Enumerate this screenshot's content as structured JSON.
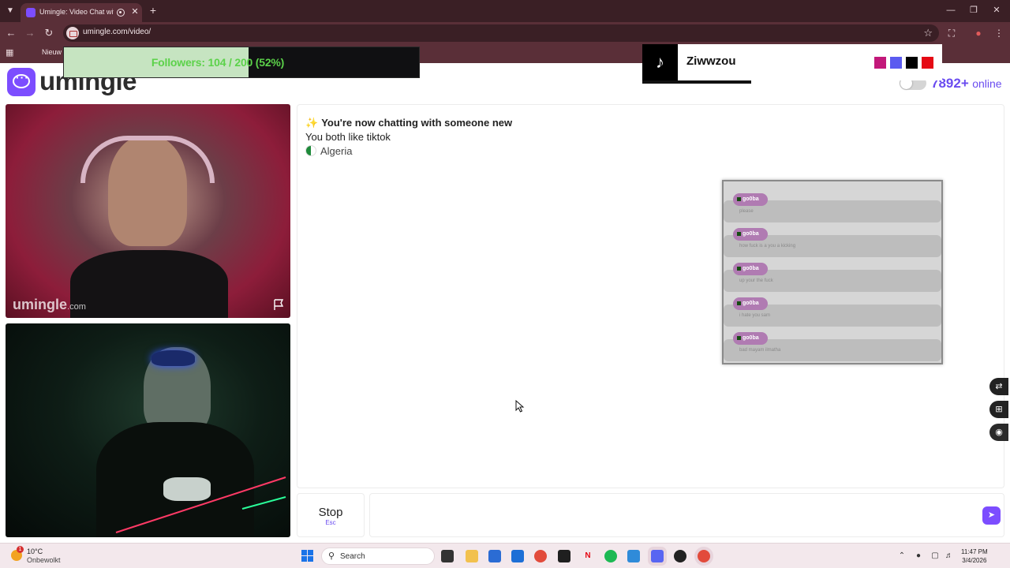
{
  "browser": {
    "tab_title": "Umingle: Video Chat with S",
    "url": "umingle.com/video/",
    "bookmark": "Nieuw"
  },
  "overlay": {
    "followers_text": "Followers: 104 / 200 (52%)",
    "followers_progress": 0.52,
    "tiktok_name": "Ziwwzou",
    "swatch_colors": [
      "#c2187a",
      "#5b5bf0",
      "#000000",
      "#e50914"
    ]
  },
  "site": {
    "logo_text": "umingle",
    "online_count": "7892+",
    "online_label": "online",
    "watermark_main": "umingle",
    "watermark_suffix": ".com",
    "accent": "#7c4dff"
  },
  "chat": {
    "new_chat": "You're now chatting with someone new",
    "common_interest": "You both like tiktok",
    "country": "Algeria"
  },
  "overlay_chat": {
    "messages": [
      {
        "user": "go0ba",
        "text": "please"
      },
      {
        "user": "go0ba",
        "text": "how fuck is a you a kicking"
      },
      {
        "user": "go0ba",
        "text": "up your the fuck"
      },
      {
        "user": "go0ba",
        "text": "i hate you sam"
      },
      {
        "user": "go0ba",
        "text": "bad mayam ilmatha"
      }
    ]
  },
  "controls": {
    "stop_label": "Stop",
    "stop_hint": "Esc",
    "message_placeholder": ""
  },
  "taskbar": {
    "weather_badge": "1",
    "weather_temp": "10°C",
    "weather_desc": "Onbewolkt",
    "search_label": "Search",
    "time": "11:47 PM",
    "date": "3/4/2026"
  }
}
